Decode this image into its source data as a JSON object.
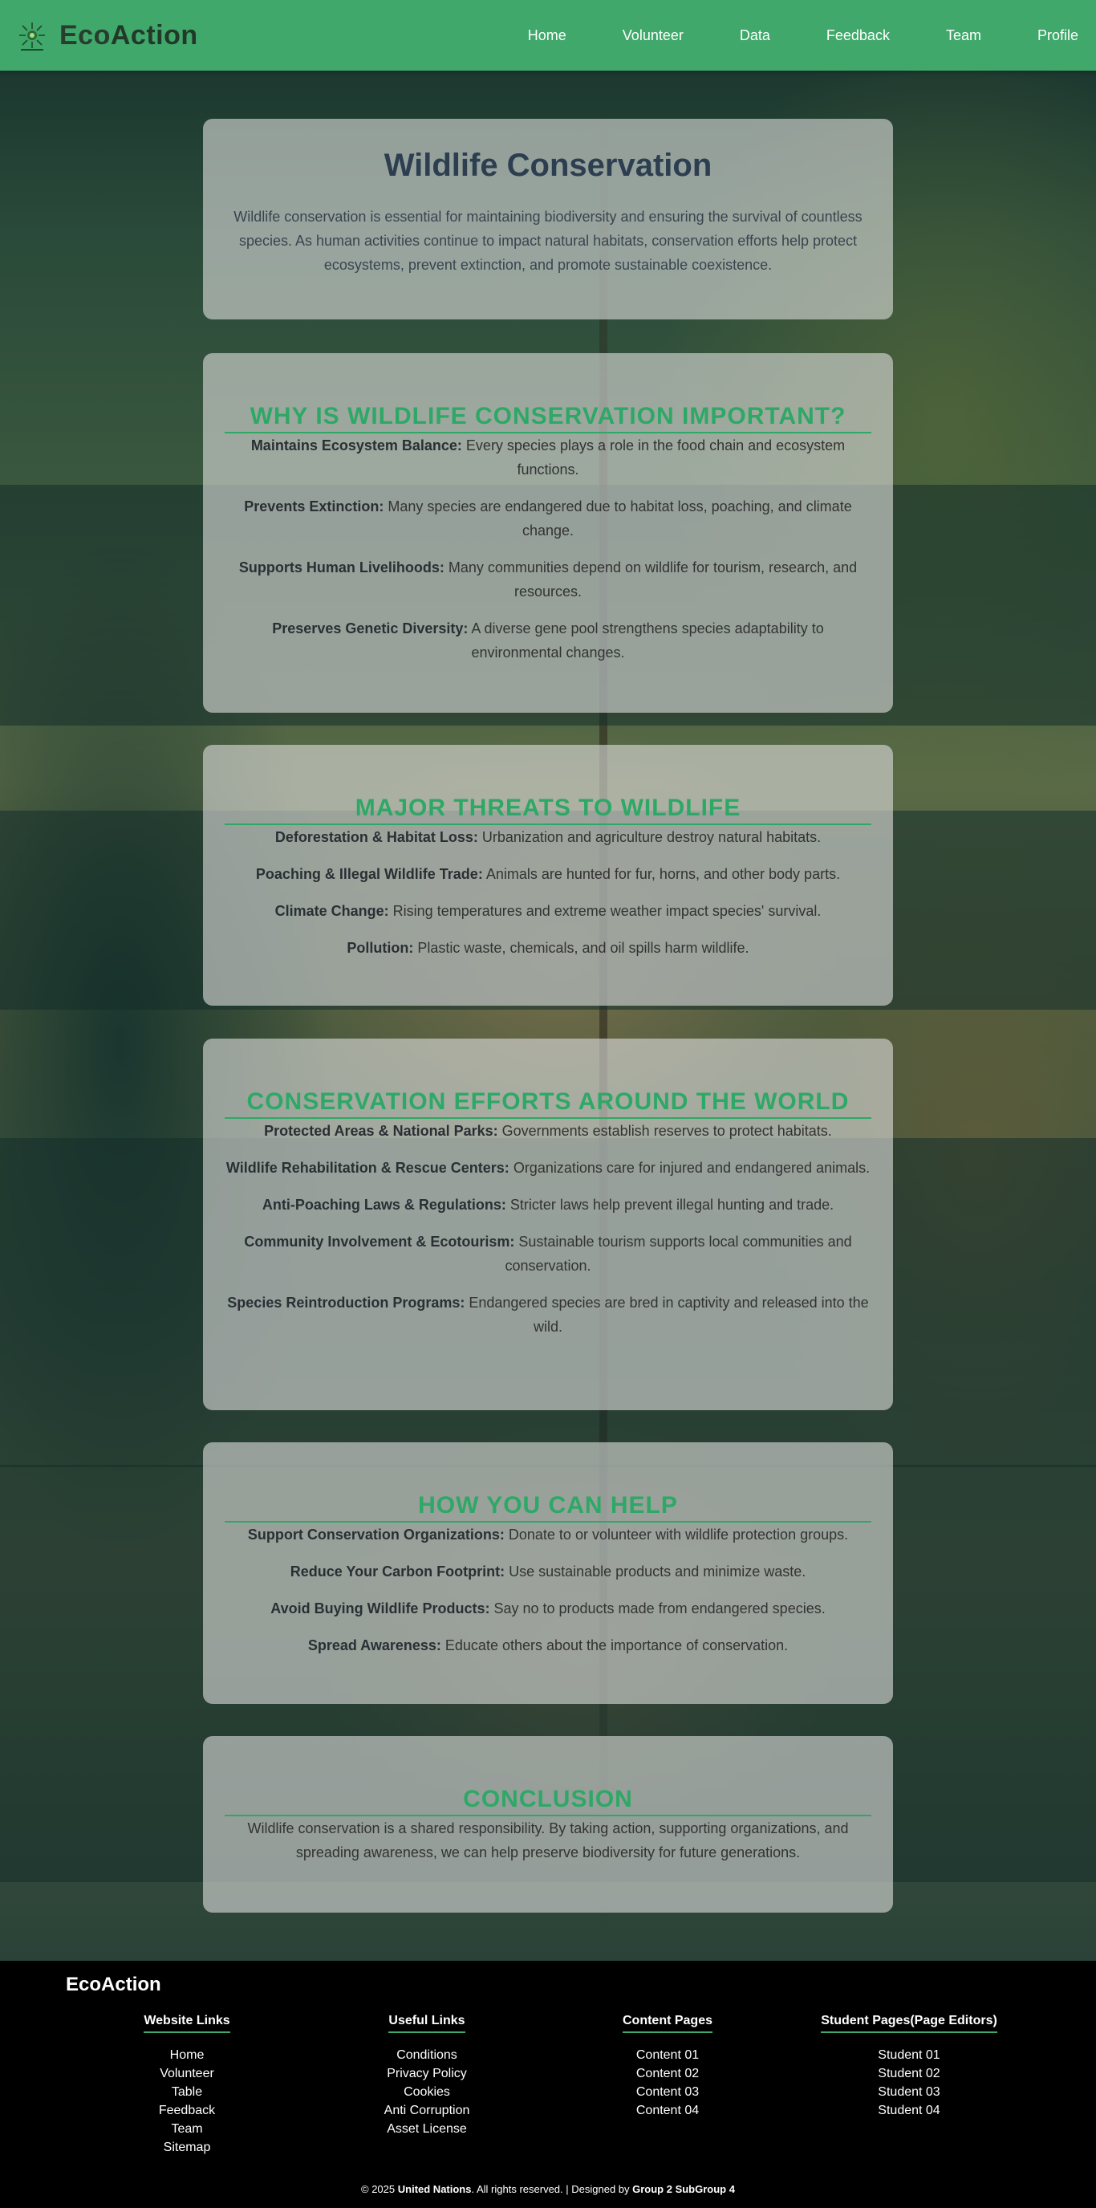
{
  "brand": {
    "name_part1": "Eco",
    "name_part2": "Action",
    "logo_icon": "eco-sun-icon"
  },
  "nav": [
    "Home",
    "Volunteer",
    "Data",
    "Feedback",
    "Team",
    "Profile"
  ],
  "hero": {
    "title": "Wildlife Conservation",
    "text": "Wildlife conservation is essential for maintaining biodiversity and ensuring the survival of countless species. As human activities continue to impact natural habitats, conservation efforts help protect ecosystems, prevent extinction, and promote sustainable coexistence."
  },
  "sections": [
    {
      "title": "WHY IS WILDLIFE CONSERVATION IMPORTANT?",
      "items": [
        {
          "label": "Maintains Ecosystem Balance:",
          "text": " Every species plays a role in the food chain and ecosystem functions."
        },
        {
          "label": "Prevents Extinction:",
          "text": " Many species are endangered due to habitat loss, poaching, and climate change."
        },
        {
          "label": "Supports Human Livelihoods:",
          "text": " Many communities depend on wildlife for tourism, research, and resources."
        },
        {
          "label": "Preserves Genetic Diversity:",
          "text": " A diverse gene pool strengthens species adaptability to environmental changes."
        }
      ]
    },
    {
      "title": "MAJOR THREATS TO WILDLIFE",
      "items": [
        {
          "label": "Deforestation & Habitat Loss:",
          "text": " Urbanization and agriculture destroy natural habitats."
        },
        {
          "label": "Poaching & Illegal Wildlife Trade:",
          "text": " Animals are hunted for fur, horns, and other body parts."
        },
        {
          "label": "Climate Change:",
          "text": " Rising temperatures and extreme weather impact species' survival."
        },
        {
          "label": "Pollution:",
          "text": " Plastic waste, chemicals, and oil spills harm wildlife."
        }
      ]
    },
    {
      "title": "CONSERVATION EFFORTS AROUND THE WORLD",
      "items": [
        {
          "label": "Protected Areas & National Parks:",
          "text": " Governments establish reserves to protect habitats."
        },
        {
          "label": "Wildlife Rehabilitation & Rescue Centers:",
          "text": " Organizations care for injured and endangered animals."
        },
        {
          "label": "Anti-Poaching Laws & Regulations:",
          "text": " Stricter laws help prevent illegal hunting and trade."
        },
        {
          "label": "Community Involvement & Ecotourism:",
          "text": " Sustainable tourism supports local communities and conservation."
        },
        {
          "label": "Species Reintroduction Programs:",
          "text": " Endangered species are bred in captivity and released into the wild."
        }
      ]
    },
    {
      "title": "HOW YOU CAN HELP",
      "items": [
        {
          "label": "Support Conservation Organizations:",
          "text": " Donate to or volunteer with wildlife protection groups."
        },
        {
          "label": "Reduce Your Carbon Footprint:",
          "text": " Use sustainable products and minimize waste."
        },
        {
          "label": "Avoid Buying Wildlife Products:",
          "text": " Say no to products made from endangered species."
        },
        {
          "label": "Spread Awareness:",
          "text": " Educate others about the importance of conservation."
        }
      ]
    }
  ],
  "conclusion": {
    "title": "CONCLUSION",
    "text": "Wildlife conservation is a shared responsibility. By taking action, supporting organizations, and spreading awareness, we can help preserve biodiversity for future generations."
  },
  "footer": {
    "brand": "EcoAction",
    "columns": [
      {
        "title": "Website Links",
        "links": [
          "Home",
          "Volunteer",
          "Table",
          "Feedback",
          "Team",
          "Sitemap"
        ]
      },
      {
        "title": "Useful Links",
        "links": [
          "Conditions",
          "Privacy Policy",
          "Cookies",
          "Anti Corruption",
          "Asset License"
        ]
      },
      {
        "title": "Content Pages",
        "links": [
          "Content 01",
          "Content 02",
          "Content 03",
          "Content 04"
        ]
      },
      {
        "title": "Student Pages(Page Editors)",
        "links": [
          "Student 01",
          "Student 02",
          "Student 03",
          "Student 04"
        ]
      }
    ],
    "copyright_prefix": "© 2025 ",
    "copyright_org": "United Nations",
    "copyright_mid": ". All rights reserved. | Designed by ",
    "copyright_team": "Group 2 SubGroup 4"
  },
  "colors": {
    "header": "#3fa86a",
    "heading_green": "#2ea866",
    "footer": "#000000"
  }
}
